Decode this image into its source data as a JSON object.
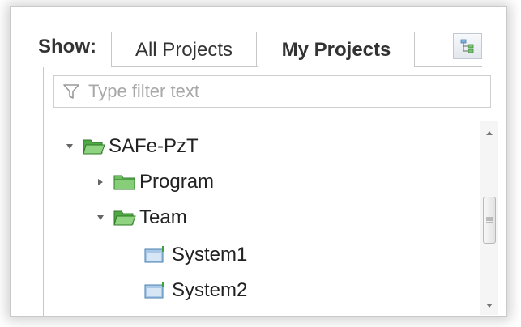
{
  "toolbar": {
    "show_label": "Show:",
    "tabs": [
      {
        "label": "All Projects",
        "active": false
      },
      {
        "label": "My Projects",
        "active": true
      }
    ],
    "structure_button_icon": "tree-structure-icon"
  },
  "filter": {
    "placeholder": "Type filter text",
    "icon": "filter-icon"
  },
  "tree": {
    "items": [
      {
        "label": "SAFe-PzT",
        "expanded": true,
        "icon": "open-folder-icon"
      },
      {
        "label": "Program",
        "expanded": false,
        "icon": "folder-icon"
      },
      {
        "label": "Team",
        "expanded": true,
        "icon": "open-folder-icon"
      },
      {
        "label": "System1",
        "icon": "system-icon"
      },
      {
        "label": "System2",
        "icon": "system-icon"
      }
    ]
  },
  "colors": {
    "folder_green": "#58b84a",
    "system_blue": "#5b8fc7",
    "border": "#c8c8c8"
  }
}
